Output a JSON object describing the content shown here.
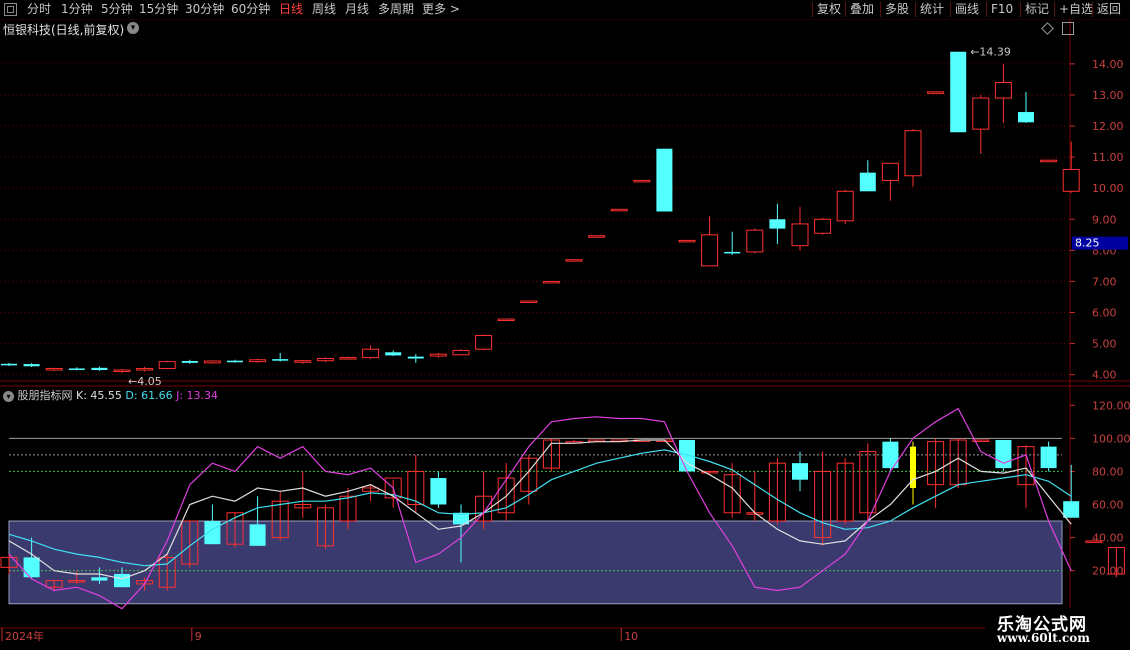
{
  "toolbar": {
    "periods": [
      {
        "label": "分时",
        "active": false
      },
      {
        "label": "1分钟",
        "active": false
      },
      {
        "label": "5分钟",
        "active": false
      },
      {
        "label": "15分钟",
        "active": false
      },
      {
        "label": "30分钟",
        "active": false
      },
      {
        "label": "60分钟",
        "active": false
      },
      {
        "label": "日线",
        "active": true
      },
      {
        "label": "周线",
        "active": false
      },
      {
        "label": "月线",
        "active": false
      },
      {
        "label": "多周期",
        "active": false
      },
      {
        "label": "更多 >",
        "active": false
      }
    ],
    "right": [
      "复权",
      "叠加",
      "多股",
      "统计",
      "画线",
      "F10",
      "标记",
      "+自选",
      "返回"
    ]
  },
  "stock_title": "恒银科技(日线,前复权)",
  "kdj_legend": {
    "name": "股朋指标网",
    "k": "K: 45.55",
    "d": "D: 61.66",
    "j": "J: 13.34"
  },
  "colors": {
    "up": "#ff3030",
    "down": "#54ffff",
    "highlight": "#ffff00",
    "k": "#e0e0e0",
    "d": "#40e0f0",
    "j": "#e040e0",
    "band": "#3a3a6e",
    "current": "#0000a0"
  },
  "watermark": {
    "title": "乐淘公式网",
    "url": "www.60lt.com"
  },
  "chart_data": {
    "type": "candlestick",
    "price_axis": {
      "range": [
        3.7,
        14.8
      ],
      "ticks": [
        "14.00",
        "13.00",
        "12.00",
        "11.00",
        "10.00",
        "9.00",
        "8.00",
        "7.00",
        "6.00",
        "5.00",
        "4.00"
      ],
      "current": "8.25"
    },
    "annotations": {
      "high": "14.39",
      "low": "4.05"
    },
    "candles": [
      {
        "o": 4.35,
        "h": 4.38,
        "l": 4.28,
        "c": 4.3
      },
      {
        "o": 4.34,
        "h": 4.37,
        "l": 4.25,
        "c": 4.27
      },
      {
        "o": 4.15,
        "h": 4.22,
        "l": 4.12,
        "c": 4.2
      },
      {
        "o": 4.2,
        "h": 4.24,
        "l": 4.14,
        "c": 4.18
      },
      {
        "o": 4.22,
        "h": 4.26,
        "l": 4.12,
        "c": 4.15
      },
      {
        "o": 4.12,
        "h": 4.18,
        "l": 4.05,
        "c": 4.15
      },
      {
        "o": 4.15,
        "h": 4.25,
        "l": 4.1,
        "c": 4.2
      },
      {
        "o": 4.2,
        "h": 4.45,
        "l": 4.18,
        "c": 4.42
      },
      {
        "o": 4.44,
        "h": 4.48,
        "l": 4.35,
        "c": 4.38
      },
      {
        "o": 4.38,
        "h": 4.46,
        "l": 4.35,
        "c": 4.44
      },
      {
        "o": 4.45,
        "h": 4.48,
        "l": 4.38,
        "c": 4.4
      },
      {
        "o": 4.42,
        "h": 4.52,
        "l": 4.38,
        "c": 4.48
      },
      {
        "o": 4.5,
        "h": 4.7,
        "l": 4.42,
        "c": 4.45
      },
      {
        "o": 4.4,
        "h": 4.48,
        "l": 4.35,
        "c": 4.45
      },
      {
        "o": 4.45,
        "h": 4.56,
        "l": 4.4,
        "c": 4.52
      },
      {
        "o": 4.55,
        "h": 4.58,
        "l": 4.5,
        "c": 4.55
      },
      {
        "o": 4.55,
        "h": 4.95,
        "l": 4.5,
        "c": 4.82
      },
      {
        "o": 4.72,
        "h": 4.78,
        "l": 4.6,
        "c": 4.62
      },
      {
        "o": 4.58,
        "h": 4.66,
        "l": 4.38,
        "c": 4.52
      },
      {
        "o": 4.6,
        "h": 4.7,
        "l": 4.55,
        "c": 4.66
      },
      {
        "o": 4.64,
        "h": 4.82,
        "l": 4.62,
        "c": 4.78
      },
      {
        "o": 4.82,
        "h": 5.3,
        "l": 4.78,
        "c": 5.26
      },
      {
        "o": 5.79,
        "h": 5.79,
        "l": 5.79,
        "c": 5.79
      },
      {
        "o": 6.37,
        "h": 6.37,
        "l": 6.37,
        "c": 6.37
      },
      {
        "o": 7.0,
        "h": 7.0,
        "l": 7.0,
        "c": 7.0
      },
      {
        "o": 7.7,
        "h": 7.7,
        "l": 7.7,
        "c": 7.7
      },
      {
        "o": 8.47,
        "h": 8.47,
        "l": 8.47,
        "c": 8.47
      },
      {
        "o": 9.32,
        "h": 9.32,
        "l": 9.32,
        "c": 9.32
      },
      {
        "o": 10.25,
        "h": 10.25,
        "l": 10.25,
        "c": 10.25
      },
      {
        "o": 11.27,
        "h": 11.27,
        "l": 9.25,
        "c": 9.25
      },
      {
        "o": 8.32,
        "h": 8.32,
        "l": 8.32,
        "c": 8.32
      },
      {
        "o": 7.5,
        "h": 9.1,
        "l": 7.5,
        "c": 8.5
      },
      {
        "o": 7.95,
        "h": 8.6,
        "l": 7.85,
        "c": 7.9
      },
      {
        "o": 7.95,
        "h": 8.7,
        "l": 7.9,
        "c": 8.65
      },
      {
        "o": 9.0,
        "h": 9.5,
        "l": 8.2,
        "c": 8.7
      },
      {
        "o": 8.15,
        "h": 9.4,
        "l": 8.0,
        "c": 8.85
      },
      {
        "o": 8.55,
        "h": 9.05,
        "l": 8.5,
        "c": 9.0
      },
      {
        "o": 8.95,
        "h": 9.95,
        "l": 8.85,
        "c": 9.9
      },
      {
        "o": 10.5,
        "h": 10.9,
        "l": 9.9,
        "c": 9.9
      },
      {
        "o": 10.25,
        "h": 10.8,
        "l": 9.6,
        "c": 10.8
      },
      {
        "o": 10.4,
        "h": 11.9,
        "l": 10.05,
        "c": 11.85
      },
      {
        "o": 13.1,
        "h": 13.1,
        "l": 13.1,
        "c": 13.1
      },
      {
        "o": 14.39,
        "h": 14.39,
        "l": 11.8,
        "c": 11.8
      },
      {
        "o": 11.9,
        "h": 13.0,
        "l": 11.1,
        "c": 12.9
      },
      {
        "o": 12.9,
        "h": 14.0,
        "l": 12.1,
        "c": 13.4
      },
      {
        "o": 12.45,
        "h": 13.1,
        "l": 12.1,
        "c": 12.12
      },
      {
        "o": 10.9,
        "h": 10.9,
        "l": 10.9,
        "c": 10.9
      },
      {
        "o": 9.9,
        "h": 11.5,
        "l": 9.85,
        "c": 10.6
      }
    ],
    "kdj_axis": {
      "range": [
        -5,
        125
      ],
      "ticks": [
        "120.00",
        "100.00",
        "80.00",
        "60.00",
        "40.00",
        "20.00"
      ],
      "lines": [
        100,
        90,
        80,
        20
      ],
      "band": [
        0,
        50
      ]
    },
    "kdj": {
      "k": [
        38,
        30,
        20,
        18,
        18,
        15,
        20,
        30,
        60,
        65,
        62,
        70,
        68,
        70,
        65,
        68,
        72,
        65,
        55,
        45,
        47,
        55,
        65,
        80,
        97,
        97,
        98,
        98,
        99,
        99,
        85,
        78,
        70,
        55,
        45,
        38,
        36,
        38,
        50,
        60,
        75,
        80,
        88,
        80,
        79,
        82,
        65,
        48
      ],
      "d": [
        42,
        38,
        33,
        30,
        28,
        25,
        23,
        24,
        35,
        45,
        52,
        58,
        60,
        62,
        62,
        64,
        67,
        66,
        62,
        55,
        54,
        55,
        58,
        66,
        75,
        80,
        85,
        88,
        91,
        93,
        90,
        86,
        81,
        72,
        63,
        55,
        49,
        45,
        46,
        50,
        58,
        65,
        72,
        74,
        76,
        78,
        74,
        65
      ],
      "j": [
        30,
        15,
        8,
        10,
        5,
        -3,
        12,
        38,
        72,
        85,
        80,
        95,
        88,
        95,
        80,
        78,
        82,
        70,
        25,
        30,
        40,
        55,
        75,
        95,
        110,
        112,
        113,
        112,
        112,
        110,
        80,
        55,
        35,
        10,
        8,
        10,
        20,
        30,
        50,
        80,
        100,
        110,
        118,
        92,
        85,
        90,
        50,
        20
      ]
    },
    "kdj_boxes": [
      {
        "o": 22,
        "h": 30,
        "l": 18,
        "c": 28
      },
      {
        "o": 28,
        "h": 40,
        "l": 15,
        "c": 16
      },
      {
        "o": 10,
        "h": 14,
        "l": 8,
        "c": 14
      },
      {
        "o": 14,
        "h": 20,
        "l": 12,
        "c": 14
      },
      {
        "o": 16,
        "h": 22,
        "l": 12,
        "c": 14
      },
      {
        "o": 18,
        "h": 22,
        "l": 10,
        "c": 10
      },
      {
        "o": 12,
        "h": 16,
        "l": 8,
        "c": 14
      },
      {
        "o": 10,
        "h": 30,
        "l": 8,
        "c": 28
      },
      {
        "o": 24,
        "h": 50,
        "l": 22,
        "c": 50
      },
      {
        "o": 50,
        "h": 60,
        "l": 36,
        "c": 36
      },
      {
        "o": 36,
        "h": 55,
        "l": 34,
        "c": 55
      },
      {
        "o": 48,
        "h": 65,
        "l": 38,
        "c": 35
      },
      {
        "o": 40,
        "h": 68,
        "l": 38,
        "c": 62
      },
      {
        "o": 58,
        "h": 80,
        "l": 52,
        "c": 60
      },
      {
        "o": 35,
        "h": 60,
        "l": 33,
        "c": 58
      },
      {
        "o": 50,
        "h": 70,
        "l": 45,
        "c": 65
      },
      {
        "o": 68,
        "h": 72,
        "l": 62,
        "c": 70
      },
      {
        "o": 64,
        "h": 75,
        "l": 58,
        "c": 76
      },
      {
        "o": 60,
        "h": 90,
        "l": 55,
        "c": 80
      },
      {
        "o": 76,
        "h": 80,
        "l": 58,
        "c": 60
      },
      {
        "o": 55,
        "h": 60,
        "l": 25,
        "c": 48
      },
      {
        "o": 50,
        "h": 80,
        "l": 45,
        "c": 65
      },
      {
        "o": 55,
        "h": 85,
        "l": 50,
        "c": 76
      },
      {
        "o": 68,
        "h": 90,
        "l": 60,
        "c": 88
      },
      {
        "o": 82,
        "h": 100,
        "l": 80,
        "c": 99
      },
      {
        "o": 98,
        "h": 99,
        "l": 98,
        "c": 98
      },
      {
        "o": 98,
        "h": 99,
        "l": 98,
        "c": 99
      },
      {
        "o": 99,
        "h": 99,
        "l": 99,
        "c": 99
      },
      {
        "o": 99,
        "h": 99,
        "l": 99,
        "c": 99
      },
      {
        "o": 99,
        "h": 99,
        "l": 99,
        "c": 99
      },
      {
        "o": 99,
        "h": 99,
        "l": 80,
        "c": 80
      },
      {
        "o": 80,
        "h": 80,
        "l": 79,
        "c": 80
      },
      {
        "o": 55,
        "h": 85,
        "l": 52,
        "c": 78
      },
      {
        "o": 55,
        "h": 80,
        "l": 50,
        "c": 55
      },
      {
        "o": 50,
        "h": 88,
        "l": 48,
        "c": 85
      },
      {
        "o": 85,
        "h": 92,
        "l": 68,
        "c": 75
      },
      {
        "o": 40,
        "h": 92,
        "l": 35,
        "c": 80
      },
      {
        "o": 50,
        "h": 88,
        "l": 48,
        "c": 85
      },
      {
        "o": 55,
        "h": 97,
        "l": 50,
        "c": 92
      },
      {
        "o": 98,
        "h": 100,
        "l": 80,
        "c": 82
      },
      {
        "o": 70,
        "h": 98,
        "l": 60,
        "c": 95
      },
      {
        "o": 72,
        "h": 100,
        "l": 58,
        "c": 98
      },
      {
        "o": 72,
        "h": 100,
        "l": 70,
        "c": 99
      },
      {
        "o": 99,
        "h": 99,
        "l": 99,
        "c": 99
      },
      {
        "o": 99,
        "h": 99,
        "l": 80,
        "c": 82
      },
      {
        "o": 72,
        "h": 96,
        "l": 58,
        "c": 95
      },
      {
        "o": 95,
        "h": 98,
        "l": 80,
        "c": 82
      },
      {
        "o": 62,
        "h": 84,
        "l": 52,
        "c": 52
      },
      {
        "o": 38,
        "h": 38,
        "l": 38,
        "c": 38
      },
      {
        "o": 18,
        "h": 34,
        "l": 16,
        "c": 34
      }
    ],
    "highlight_index": 40,
    "time_axis": [
      {
        "label": "2024年",
        "index": 0
      },
      {
        "label": "9",
        "index": 8
      },
      {
        "label": "10",
        "index": 27
      }
    ]
  }
}
